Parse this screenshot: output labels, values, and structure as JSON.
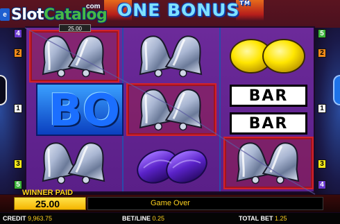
{
  "watermark": {
    "prefix": "e",
    "brand_a": "Slot",
    "brand_b": "Catalog",
    "suffix": "com"
  },
  "title": {
    "text": "ONE BONUS",
    "tm": "TM"
  },
  "win_tag": "25.00",
  "reels": [
    [
      "bell",
      "bonus",
      "bell"
    ],
    [
      "bell",
      "bell",
      "plum"
    ],
    [
      "lemon",
      "bar-bar",
      "bell"
    ]
  ],
  "winning_cells": [
    "r1-row0",
    "r2-row1",
    "r3-row2"
  ],
  "symbols": {
    "bar_text": "BAR",
    "bonus_text": "BO"
  },
  "paylines_left": [
    {
      "num": "4",
      "color": "#6a3ad0"
    },
    {
      "num": "2",
      "color": "#f08a1a"
    },
    {
      "num": "1",
      "color": "#ffffff"
    },
    {
      "num": "3",
      "color": "#f5e81a"
    },
    {
      "num": "5",
      "color": "#3cb43c"
    }
  ],
  "paylines_right": [
    {
      "num": "5",
      "color": "#3cb43c"
    },
    {
      "num": "2",
      "color": "#f08a1a"
    },
    {
      "num": "1",
      "color": "#ffffff"
    },
    {
      "num": "3",
      "color": "#f5e81a"
    },
    {
      "num": "4",
      "color": "#6a3ad0"
    }
  ],
  "panel": {
    "winner_label": "WINNER PAID",
    "winner_value": "25.00",
    "status": "Game Over"
  },
  "footer": {
    "credit_label": "CREDIT",
    "credit_value": "9,963.75",
    "betline_label": "BET/LINE",
    "betline_value": "0.25",
    "totalbet_label": "TOTAL BET",
    "totalbet_value": "1.25"
  },
  "colors": {
    "reel_bg": "#6c2a9a",
    "win_frame": "#d3212a",
    "accent_gold": "#ffd21f",
    "title_blue": "#7fe1ff"
  }
}
